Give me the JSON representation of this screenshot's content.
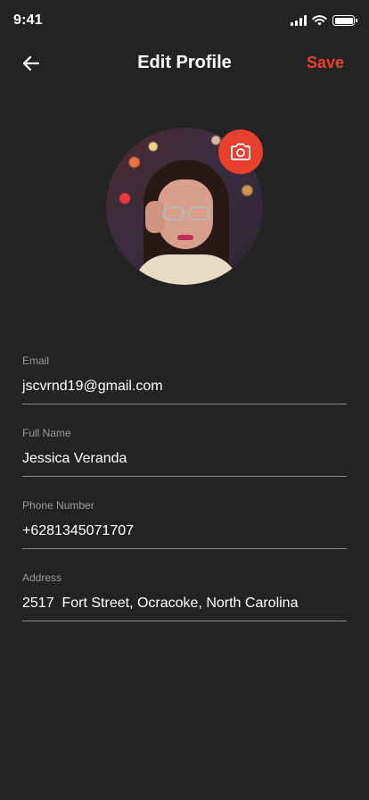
{
  "status_bar": {
    "time": "9:41"
  },
  "nav": {
    "title": "Edit Profile",
    "save_label": "Save"
  },
  "colors": {
    "accent": "#e8402f",
    "background": "#232323",
    "label": "#9a9a9a",
    "divider": "#8a8a8a"
  },
  "icons": {
    "back": "arrow-left-icon",
    "camera": "camera-icon"
  },
  "fields": [
    {
      "label": "Email",
      "value": "jscvrnd19@gmail.com"
    },
    {
      "label": "Full Name",
      "value": "Jessica Veranda"
    },
    {
      "label": "Phone Number",
      "value": "+6281345071707"
    },
    {
      "label": "Address",
      "value": "2517  Fort Street, Ocracoke, North Carolina"
    }
  ]
}
